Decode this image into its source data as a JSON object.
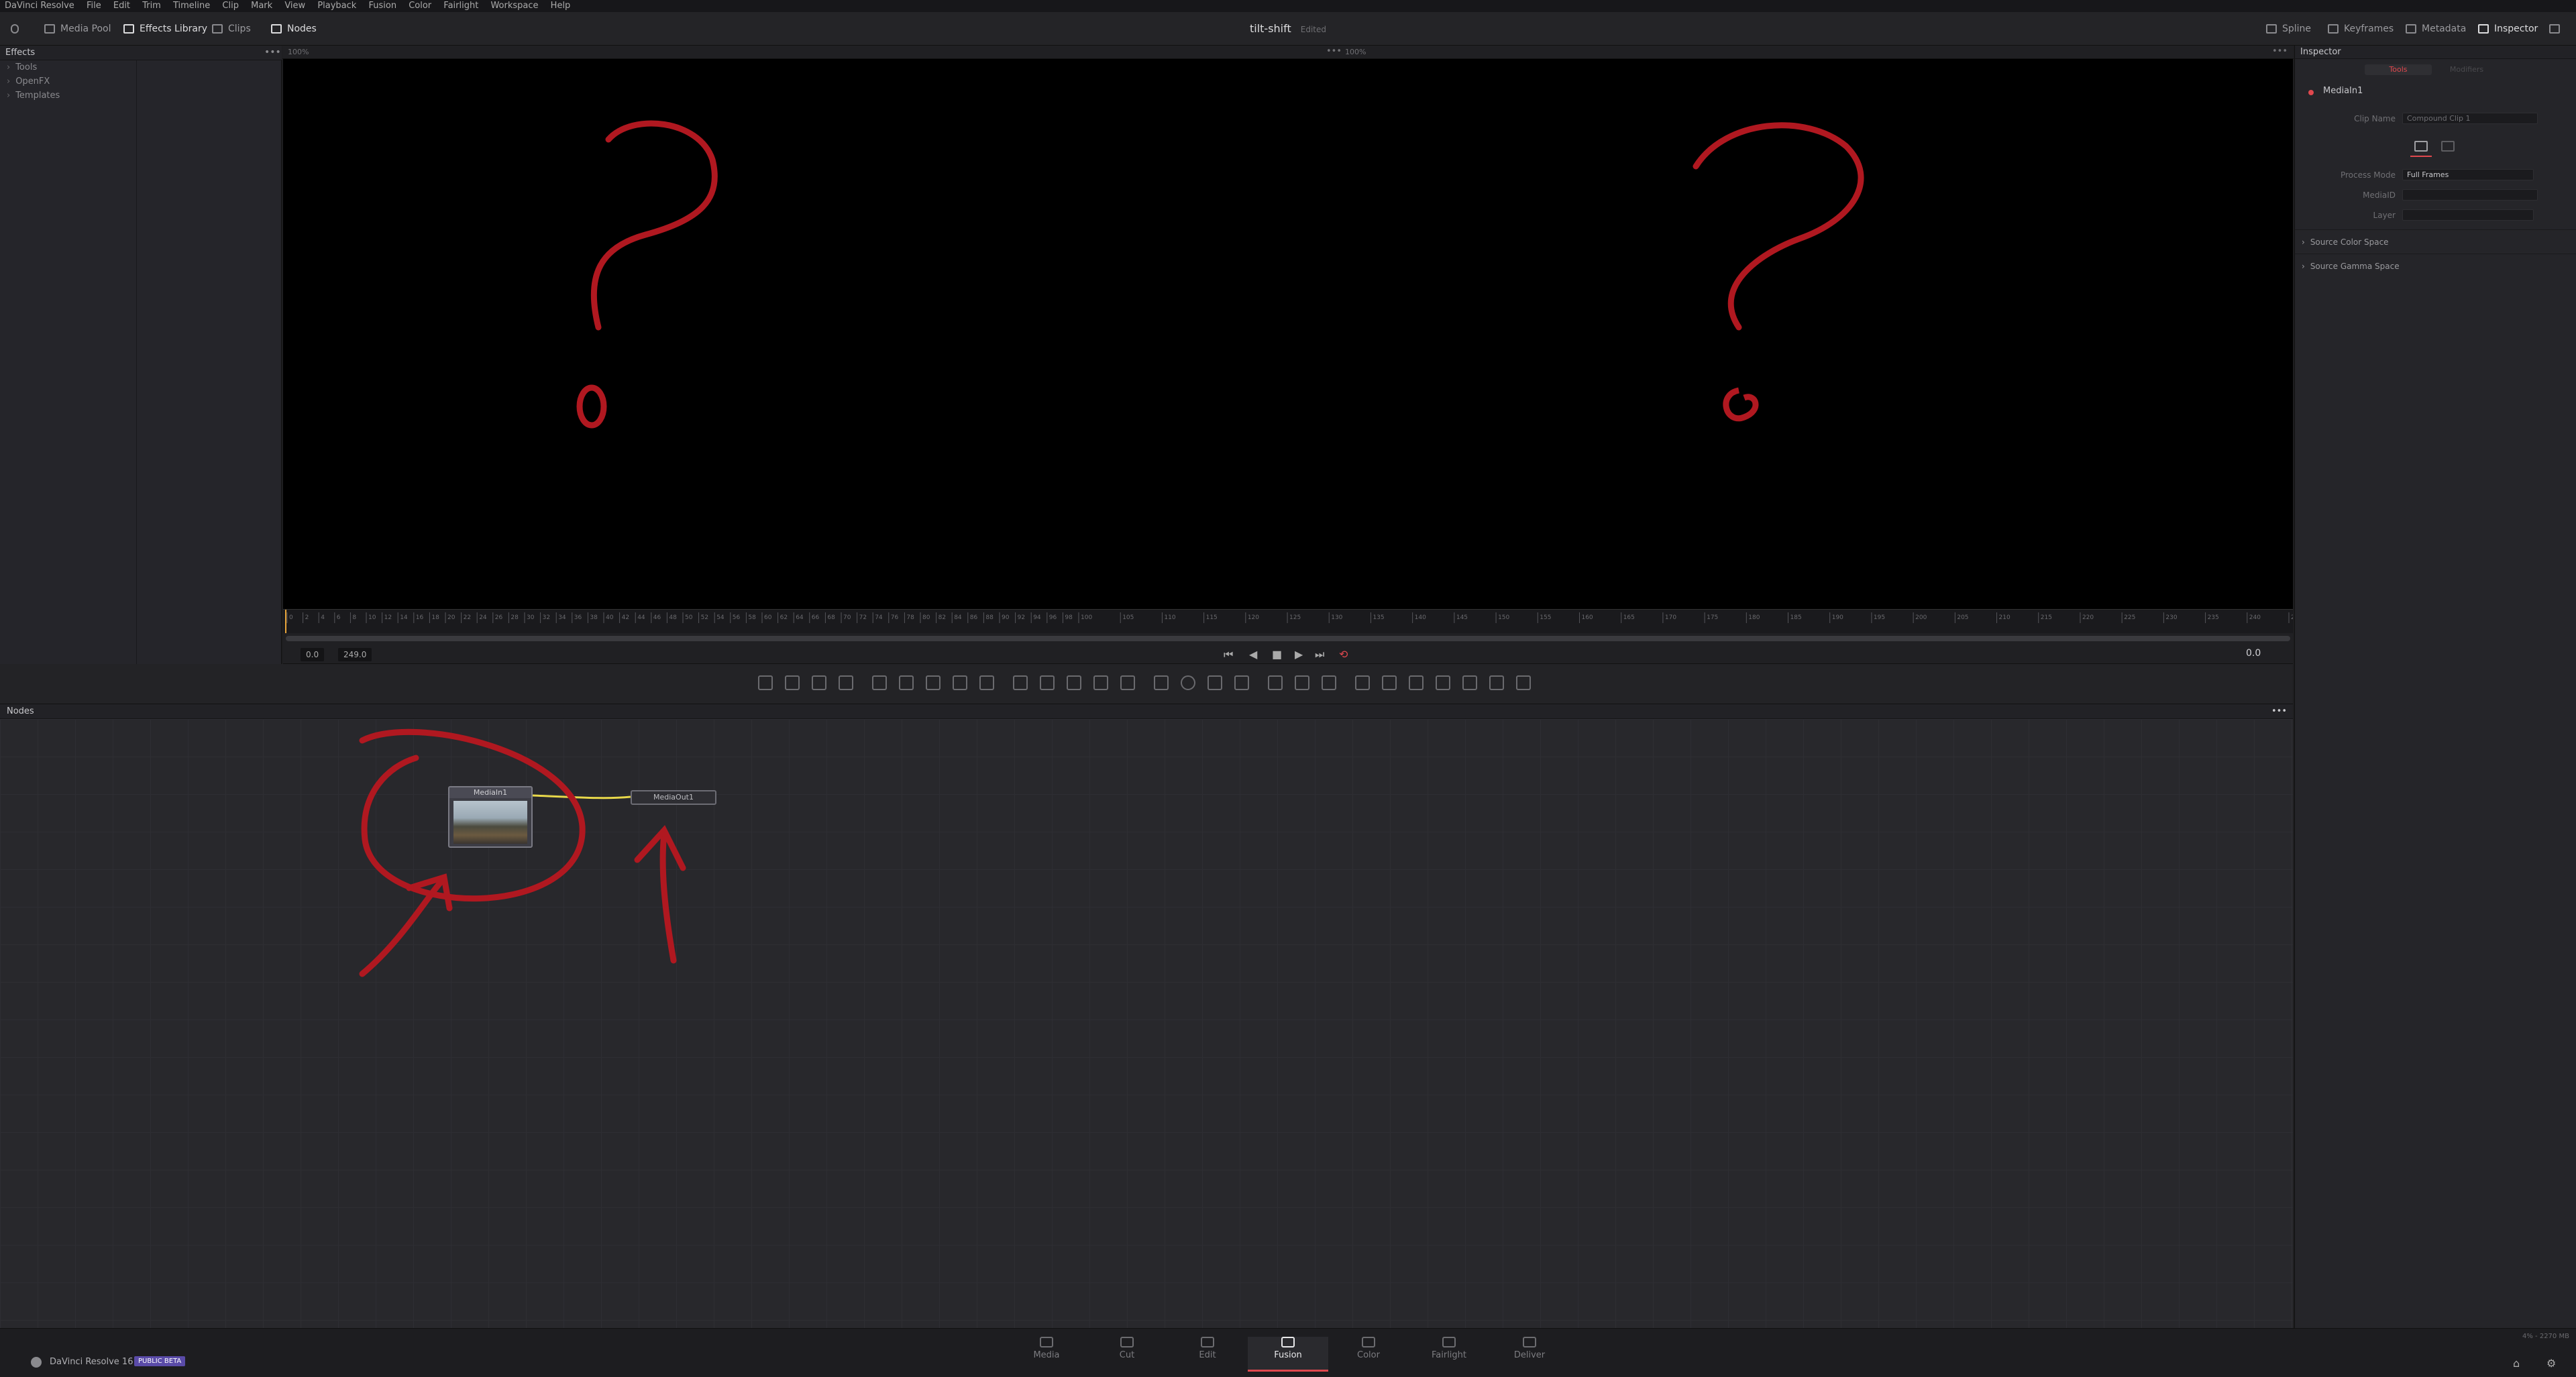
{
  "menubar": {
    "items": [
      "DaVinci Resolve",
      "File",
      "Edit",
      "Trim",
      "Timeline",
      "Clip",
      "Mark",
      "View",
      "Playback",
      "Fusion",
      "Color",
      "Fairlight",
      "Workspace",
      "Help"
    ]
  },
  "toolbar": {
    "media_pool": "Media Pool",
    "effects_library": "Effects Library",
    "clips": "Clips",
    "nodes": "Nodes",
    "project_title": "tilt-shift",
    "project_status": "Edited",
    "spline": "Spline",
    "keyframes": "Keyframes",
    "metadata": "Metadata",
    "inspector": "Inspector"
  },
  "effects": {
    "title": "Effects",
    "tree": [
      "Tools",
      "OpenFX",
      "Templates"
    ]
  },
  "viewer": {
    "zoom_left": "100%",
    "zoom_right": "100%"
  },
  "transport": {
    "in_time": "0.0",
    "out_time": "249.0",
    "current_time": "0.0"
  },
  "ruler": {
    "ticks_small": [
      "0",
      "2",
      "4",
      "6",
      "8",
      "10",
      "12",
      "14",
      "16",
      "18",
      "20",
      "22",
      "24",
      "26",
      "28",
      "30",
      "32",
      "34",
      "36",
      "38",
      "40",
      "42",
      "44",
      "46",
      "48",
      "50",
      "52",
      "54",
      "56",
      "58",
      "60",
      "62",
      "64",
      "66",
      "68",
      "70",
      "72",
      "74",
      "76",
      "78",
      "80",
      "82",
      "84",
      "86",
      "88",
      "90",
      "92",
      "94",
      "96",
      "98",
      "100"
    ],
    "ticks_large": [
      "105",
      "110",
      "115",
      "120",
      "125",
      "130",
      "135",
      "140",
      "145",
      "150",
      "155",
      "160",
      "165",
      "170",
      "175",
      "180",
      "185",
      "190",
      "195",
      "200",
      "205",
      "210",
      "215",
      "220",
      "225",
      "230",
      "235",
      "240",
      "245"
    ]
  },
  "inspector": {
    "title": "Inspector",
    "tab_tools": "Tools",
    "tab_modifiers": "Modifiers",
    "node_name": "MediaIn1",
    "clip_name_label": "Clip Name",
    "clip_name_value": "Compound Clip 1",
    "process_mode_label": "Process Mode",
    "process_mode_value": "Full Frames",
    "mediaid_label": "MediaID",
    "layer_label": "Layer",
    "section_color": "Source Color Space",
    "section_gamma": "Source Gamma Space"
  },
  "nodes": {
    "title": "Nodes",
    "media_in": "MediaIn1",
    "media_out": "MediaOut1"
  },
  "status": {
    "app_name": "DaVinci Resolve 16",
    "beta_badge": "PUBLIC BETA",
    "memory": "4% - 2270 MB",
    "pages": [
      "Media",
      "Cut",
      "Edit",
      "Fusion",
      "Color",
      "Fairlight",
      "Deliver"
    ]
  },
  "colors": {
    "accent": "#e0484e",
    "annotation": "#b01820",
    "link": "#e8d84a"
  }
}
